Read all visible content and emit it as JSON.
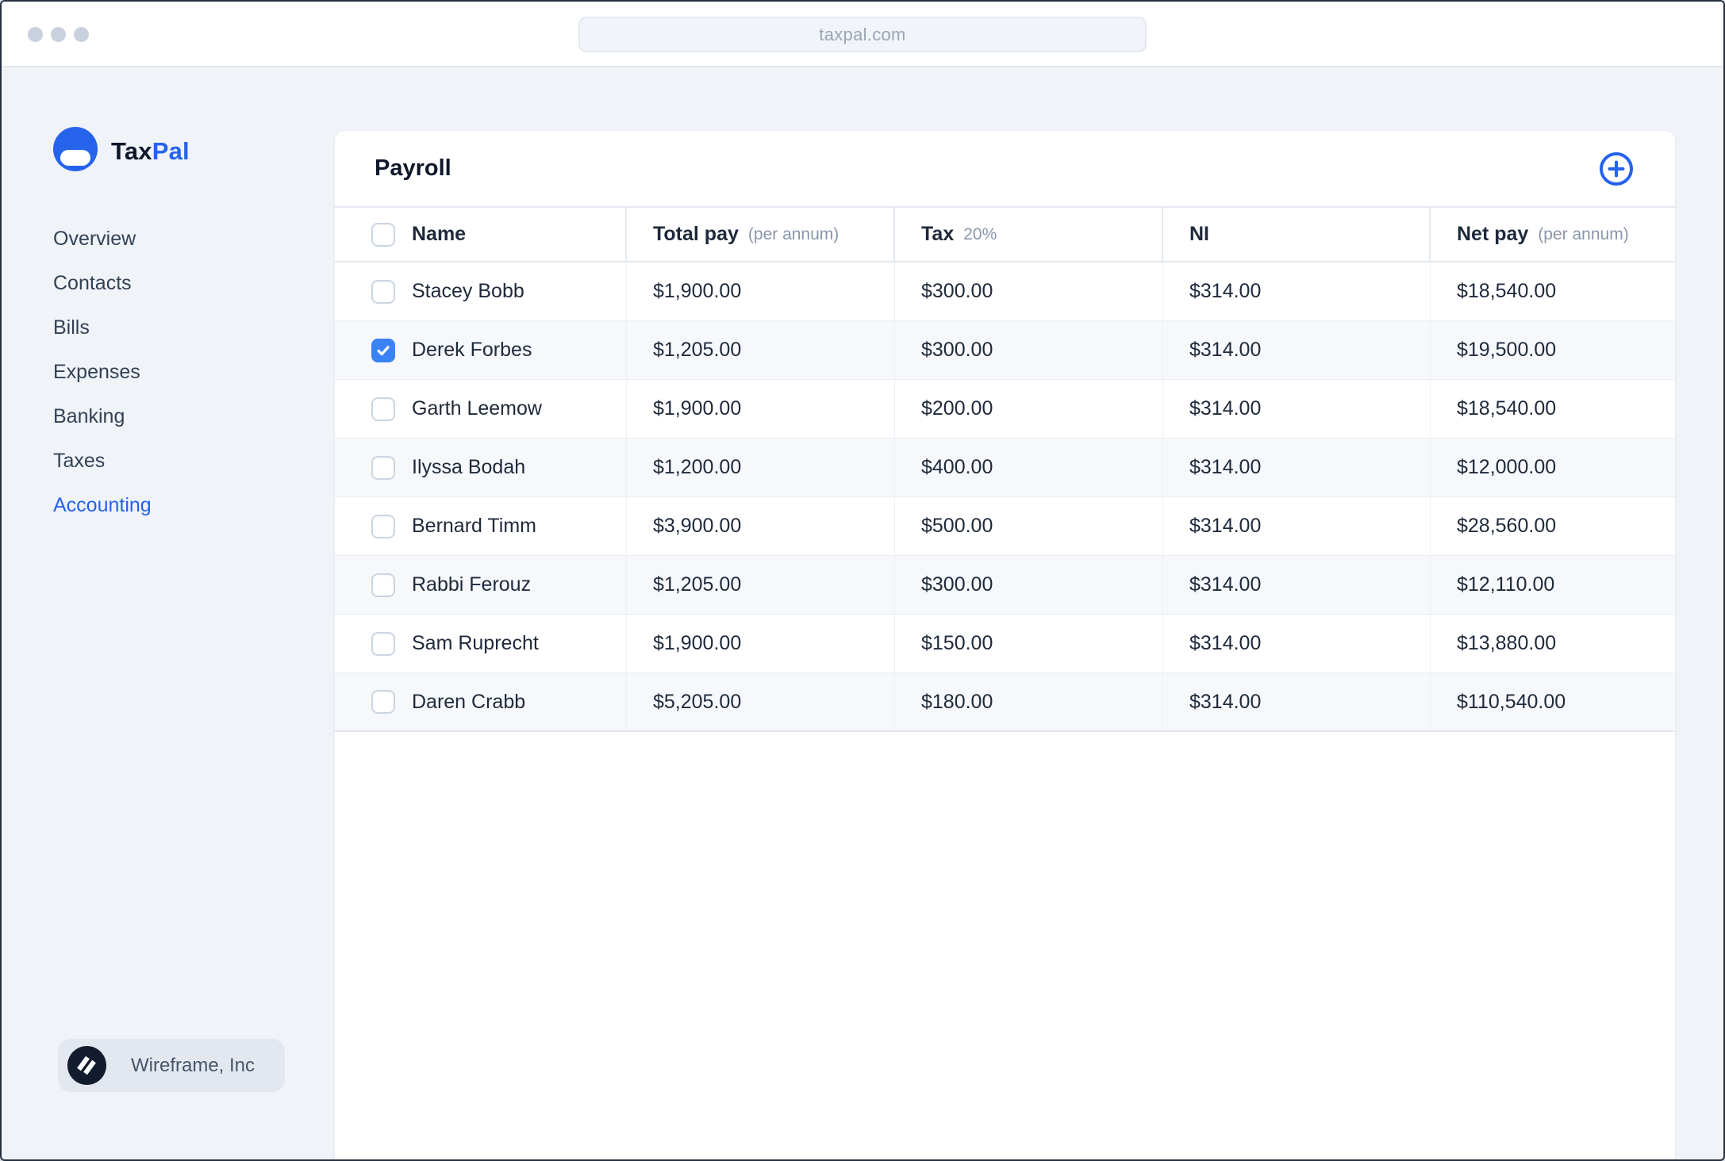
{
  "colors": {
    "accent": "#2563eb",
    "checkbox_checked": "#3b82f6",
    "row_stripe": "#f6f8fb",
    "page_background": "#f0f3f8",
    "traffic_dot": "#c9d1de",
    "org_badge": "#131c2e"
  },
  "browser": {
    "url": "taxpal.com"
  },
  "sidebar": {
    "logo": {
      "brand_prefix": "Tax",
      "brand_suffix": "Pal"
    },
    "nav": [
      {
        "label": "Overview",
        "active": false
      },
      {
        "label": "Contacts",
        "active": false
      },
      {
        "label": "Bills",
        "active": false
      },
      {
        "label": "Expenses",
        "active": false
      },
      {
        "label": "Banking",
        "active": false
      },
      {
        "label": "Taxes",
        "active": false
      },
      {
        "label": "Accounting",
        "active": true
      }
    ],
    "org": {
      "name": "Wireframe, Inc"
    }
  },
  "payroll": {
    "title": "Payroll",
    "columns": [
      {
        "label": "Name",
        "suffix": ""
      },
      {
        "label": "Total pay",
        "suffix": "(per annum)"
      },
      {
        "label": "Tax",
        "suffix": "20%"
      },
      {
        "label": "NI",
        "suffix": ""
      },
      {
        "label": "Net pay",
        "suffix": "(per annum)"
      }
    ],
    "rows": [
      {
        "name": "Stacey Bobb",
        "checked": false,
        "total_pay": "$1,900.00",
        "tax": "$300.00",
        "ni": "$314.00",
        "net_pay": "$18,540.00"
      },
      {
        "name": "Derek Forbes",
        "checked": true,
        "total_pay": "$1,205.00",
        "tax": "$300.00",
        "ni": "$314.00",
        "net_pay": "$19,500.00"
      },
      {
        "name": "Garth Leemow",
        "checked": false,
        "total_pay": "$1,900.00",
        "tax": "$200.00",
        "ni": "$314.00",
        "net_pay": "$18,540.00"
      },
      {
        "name": "Ilyssa Bodah",
        "checked": false,
        "total_pay": "$1,200.00",
        "tax": "$400.00",
        "ni": "$314.00",
        "net_pay": "$12,000.00"
      },
      {
        "name": "Bernard Timm",
        "checked": false,
        "total_pay": "$3,900.00",
        "tax": "$500.00",
        "ni": "$314.00",
        "net_pay": "$28,560.00"
      },
      {
        "name": "Rabbi Ferouz",
        "checked": false,
        "total_pay": "$1,205.00",
        "tax": "$300.00",
        "ni": "$314.00",
        "net_pay": "$12,110.00"
      },
      {
        "name": "Sam Ruprecht",
        "checked": false,
        "total_pay": "$1,900.00",
        "tax": "$150.00",
        "ni": "$314.00",
        "net_pay": "$13,880.00"
      },
      {
        "name": "Daren Crabb",
        "checked": false,
        "total_pay": "$5,205.00",
        "tax": "$180.00",
        "ni": "$314.00",
        "net_pay": "$110,540.00"
      }
    ]
  }
}
